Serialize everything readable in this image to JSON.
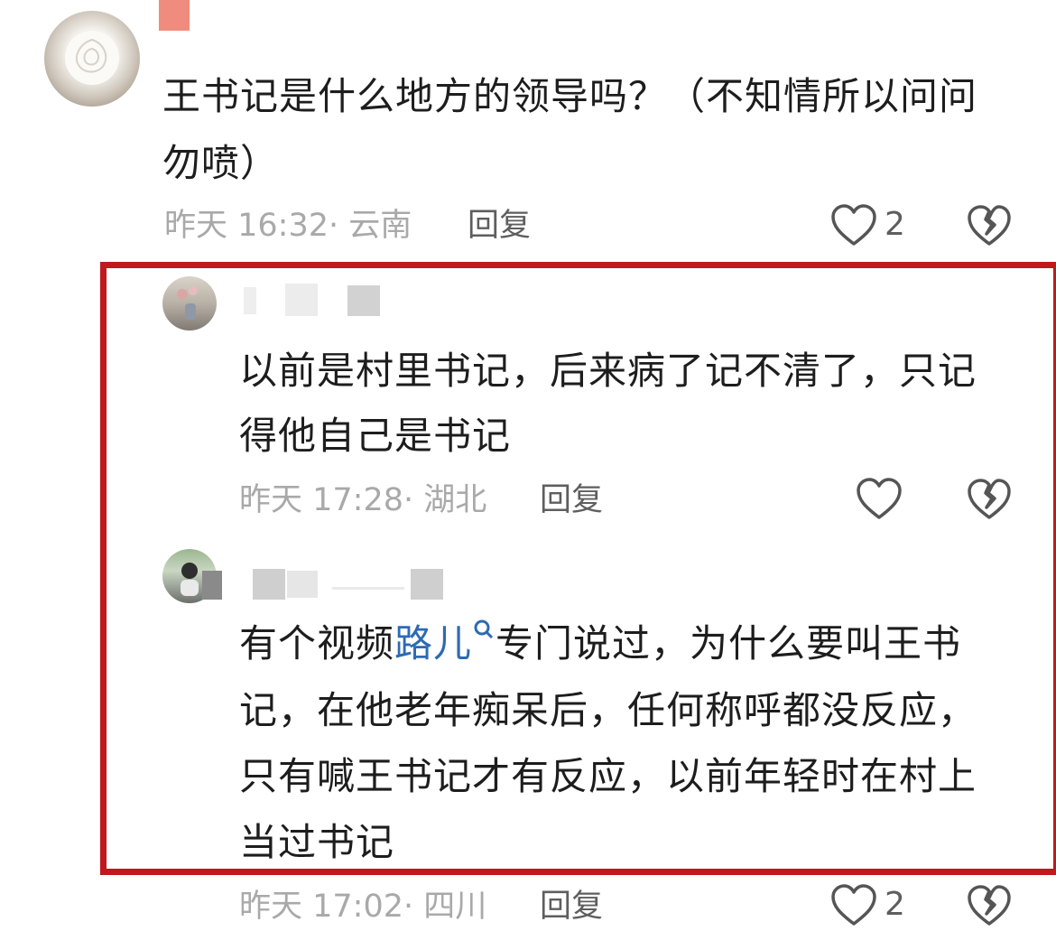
{
  "comments": [
    {
      "text_line1": "王书记是什么地方的领导吗？（不知情所以问问",
      "text_line2": "勿喷）",
      "time": "昨天 16:32",
      "location": "云南",
      "reply_label": "回复",
      "like_count": "2"
    },
    {
      "text_line1": "以前是村里书记，后来病了记不清了，只记",
      "text_line2": "得他自己是书记",
      "time": "昨天 17:28",
      "location": "湖北",
      "reply_label": "回复",
      "like_count": ""
    },
    {
      "text_line1_prefix": "有个视频",
      "text_line1_link": "路儿",
      "text_line1_suffix": "专门说过，为什么要叫王书",
      "text_line2": "记，在他老年痴呆后，任何称呼都没反应，",
      "text_line3": "只有喊王书记才有反应，以前年轻时在村上",
      "text_line4": "当过书记",
      "time": "昨天 17:02",
      "location": "四川",
      "reply_label": "回复",
      "like_count": "2"
    }
  ],
  "colors": {
    "highlight_border": "#c0181d",
    "link": "#2d6ab3"
  }
}
